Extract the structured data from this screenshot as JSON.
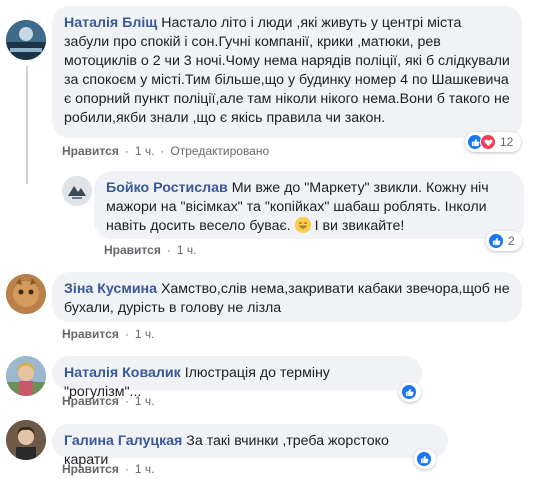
{
  "comments": [
    {
      "author": "Наталія Бліщ",
      "text": "Настало літо і люди ,які живуть у центрі міста забули про спокій і сон.Гучні компанії, крики ,матюки, рев мотоциклів о 2 чи 3 ночі.Чому нема нарядів поліції, які б слідкували за спокоєм у місті.Тим більше,що у будинку номер 4 по Шашкевича є опорний пункт поліції,але там ніколи нікого нема.Вони б такого не робили,якби знали ,що є якісь правила чи закон.",
      "like_label": "Нравится",
      "time": "1 ч.",
      "edited": "Отредактировано",
      "reaction_count": "12",
      "reactions": [
        "like",
        "love"
      ]
    },
    {
      "author": "Бойко Ростислав",
      "text_before_emoji": "Ми вже до \"Маркету\" звикли. Кожну ніч мажори на \"вісімках\" та \"копійках\" шабаш роблять. Інколи навіть досить весело буває.",
      "emoji": "grinning-face-emoji",
      "text_after_emoji": "І ви звикайте!",
      "like_label": "Нравится",
      "time": "1 ч.",
      "reaction_count": "2",
      "reactions": [
        "like"
      ]
    },
    {
      "author": "Зіна Кусмина",
      "text": "Хамство,слів нема,закривати кабаки звечора,щоб не бухали, дурість в голову не лізла",
      "like_label": "Нравится",
      "time": "1 ч."
    },
    {
      "author": "Наталія Ковалик",
      "text": "Ілюстрація до терміну \"рогулізм\"...",
      "like_label": "Нравится",
      "time": "1 ч.",
      "reactions": [
        "like"
      ]
    },
    {
      "author": "Галина Галуцкая",
      "text": "За такі вчинки ,треба жорстоко карати",
      "like_label": "Нравится",
      "time": "1 ч.",
      "reactions": [
        "like"
      ]
    }
  ],
  "colors": {
    "author": "#385898",
    "bubble": "#f0f2f5",
    "like_reaction": "#1877f2",
    "love_reaction": "#f33e58"
  }
}
